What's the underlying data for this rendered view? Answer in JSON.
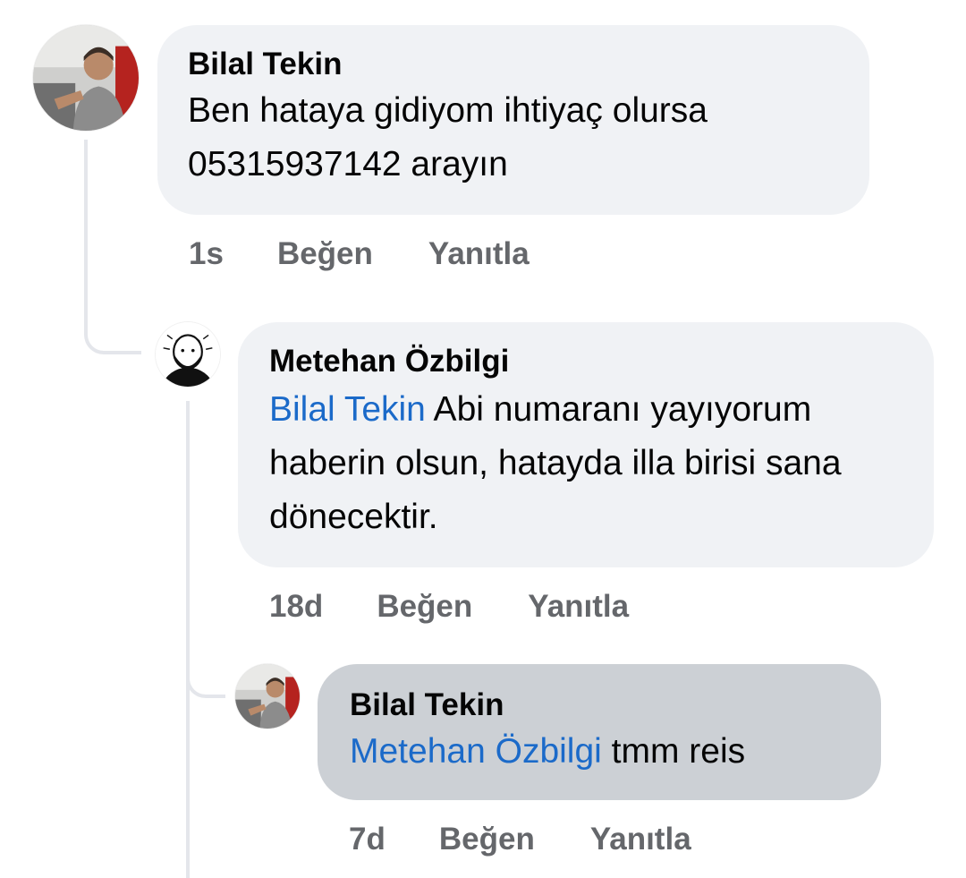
{
  "comments": [
    {
      "author": "Bilal Tekin",
      "text": "Ben hataya gidiyom ihtiyaç olursa 05315937142 arayın",
      "time": "1s",
      "like": "Beğen",
      "reply": "Yanıtla",
      "avatar_icon": "truck-driver-photo"
    },
    {
      "author": "Metehan Özbilgi",
      "mention": "Bilal Tekin",
      "text": " Abi numaranı yayıyorum haberin olsun, hatayda illa birisi sana dönecektir.",
      "time": "18d",
      "like": "Beğen",
      "reply": "Yanıtla",
      "avatar_icon": "cartoon-face-avatar"
    },
    {
      "author": "Bilal Tekin",
      "mention": "Metehan Özbilgi",
      "text": " tmm reis",
      "time": "7d",
      "like": "Beğen",
      "reply": "Yanıtla",
      "avatar_icon": "truck-driver-photo"
    }
  ],
  "colors": {
    "bubble": "#f0f2f5",
    "bubble_active": "#ccd0d5",
    "mention": "#1b6ac9",
    "meta": "#65676b",
    "thread_line": "#e4e6eb"
  }
}
